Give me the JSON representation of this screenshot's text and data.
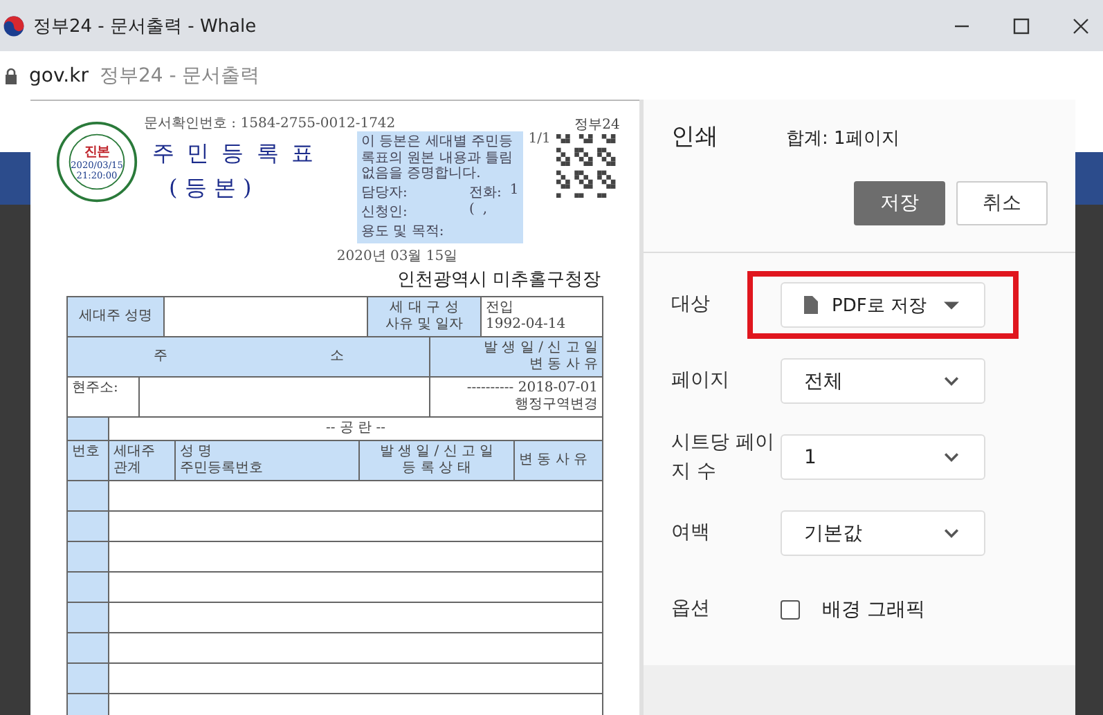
{
  "window": {
    "title": "정부24 - 문서출력 - Whale"
  },
  "address_bar": {
    "domain": "gov.kr",
    "page_title": "정부24 - 문서출력"
  },
  "document": {
    "confirmation": "문서확인번호 : 1584-2755-0012-1742",
    "page_number": "1/1",
    "stamp": {
      "label": "진본",
      "date": "2020/03/15",
      "time": "21:20:00"
    },
    "qr_label": "정부24",
    "title": "주 민 등 록 표",
    "subtitle": "( 등 본 )",
    "notice": "이 등본은 세대별 주민등록표의 원본 내용과 틀림없음을 증명합니다.",
    "notice_lines": [
      {
        "label": "담당자:",
        "extra": "전화:",
        "value": "1"
      },
      {
        "label": "신청인:",
        "extra": "(",
        "value": ","
      },
      {
        "label": "용도 및 목적:"
      }
    ],
    "date": "2020년 03월 15일",
    "issuer": "인천광역시 미추홀구청장",
    "household_head_label": "세대주 성명",
    "composition_label": [
      "세 대 구 성",
      "사유 및 일자"
    ],
    "composition_value": [
      "전입",
      "1992-04-14"
    ],
    "address_header": [
      "주",
      "소"
    ],
    "change_header": [
      "발 생 일 / 신 고 일",
      "변 동 사 유"
    ],
    "address_label": "현주소:",
    "address_dashes": "----------",
    "address_date": "2018-07-01",
    "address_reason": "행정구역변경",
    "blank_label": "-- 공 란 --",
    "member_columns": [
      [
        "번호"
      ],
      [
        "세대주",
        "관계"
      ],
      [
        "성 명",
        "주민등록번호"
      ],
      [
        "발 생 일 / 신 고 일",
        "등 록 상 태"
      ],
      [
        "변 동 사 유"
      ]
    ]
  },
  "print_panel": {
    "title": "인쇄",
    "total": "합계: 1페이지",
    "buttons": [
      {
        "label": "저장",
        "kind": "primary"
      },
      {
        "label": "취소",
        "kind": "secondary"
      }
    ],
    "settings": [
      {
        "label": "대상",
        "kind": "destination",
        "value": "PDF로 저장",
        "highlighted": true
      },
      {
        "label": "페이지",
        "kind": "select",
        "value": "전체",
        "highlighted": false
      },
      {
        "label": "시트당 페이지 수",
        "kind": "select",
        "value": "1",
        "highlighted": false
      },
      {
        "label": "여백",
        "kind": "select",
        "value": "기본값",
        "highlighted": false
      },
      {
        "label": "옵션",
        "kind": "checkbox",
        "value": "배경 그래픽",
        "checked": false,
        "highlighted": false
      }
    ]
  }
}
